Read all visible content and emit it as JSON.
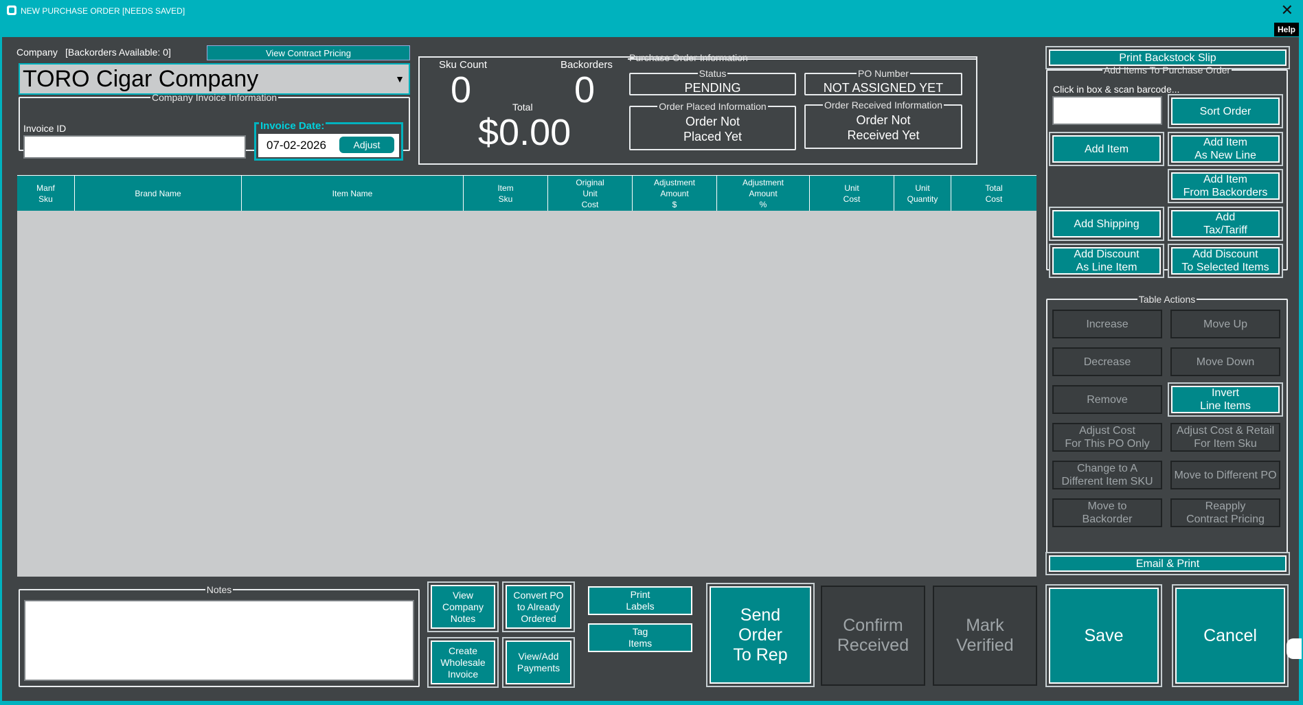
{
  "window": {
    "title": "NEW PURCHASE ORDER [NEEDS SAVED]",
    "help_label": "Help"
  },
  "company": {
    "label": "Company",
    "backorders": "[Backorders Available: 0]",
    "contract_btn": "View Contract Pricing",
    "selected": "TORO Cigar Company"
  },
  "invoice": {
    "group": "Company Invoice Information",
    "id_label": "Invoice ID",
    "id_value": "",
    "date_legend": "Invoice Date:",
    "date_value": "07-02-2026",
    "adjust": "Adjust"
  },
  "summary": {
    "sku_label": "Sku Count",
    "sku_value": "0",
    "back_label": "Backorders",
    "back_value": "0",
    "total_label": "Total",
    "total_value": "$0.00"
  },
  "po": {
    "group": "Purchase Order Information",
    "status_label": "Status",
    "status_value": "PENDING",
    "number_label": "PO Number",
    "number_value": "NOT ASSIGNED YET",
    "placed_label": "Order Placed Information",
    "placed_value": "Order Not\nPlaced Yet",
    "received_label": "Order Received Information",
    "received_value": "Order Not\nReceived Yet"
  },
  "table": {
    "columns": [
      "Manf\nSku",
      "Brand Name",
      "Item Name",
      "Item\nSku",
      "Original\nUnit\nCost",
      "Adjustment\nAmount\n$",
      "Adjustment\nAmount\n%",
      "Unit\nCost",
      "Unit\nQuantity",
      "Total\nCost"
    ],
    "rows": []
  },
  "right": {
    "print_backstock": "Print Backstock Slip",
    "add_group": "Add Items To Purchase Order",
    "scan_label": "Click in box & scan barcode...",
    "scan_value": "",
    "sort_order": "Sort Order",
    "add_item": "Add Item",
    "add_new_line": "Add Item\nAs New Line",
    "add_from_backorders": "Add Item\nFrom Backorders",
    "add_shipping": "Add Shipping",
    "add_tax": "Add\nTax/Tariff",
    "discount_line": "Add Discount\nAs Line Item",
    "discount_selected": "Add Discount\nTo Selected Items",
    "table_actions": "Table Actions",
    "increase": "Increase",
    "move_up": "Move Up",
    "decrease": "Decrease",
    "move_down": "Move Down",
    "remove": "Remove",
    "invert": "Invert\nLine Items",
    "adjust_cost": "Adjust Cost\nFor This PO Only",
    "adjust_retail": "Adjust Cost & Retail\nFor Item Sku",
    "change_sku": "Change to A\nDifferent Item SKU",
    "move_po": "Move to Different PO",
    "move_backorder": "Move to\nBackorder",
    "reapply": "Reapply\nContract Pricing",
    "email_print": "Email & Print"
  },
  "bottom": {
    "notes_label": "Notes",
    "notes_value": "",
    "view_notes": "View\nCompany\nNotes",
    "convert_po": "Convert PO\nto Already\nOrdered",
    "create_invoice": "Create\nWholesale\nInvoice",
    "payments": "View/Add\nPayments",
    "print_labels": "Print\nLabels",
    "tag_items": "Tag\nItems",
    "send_order": "Send\nOrder\nTo Rep",
    "confirm_received": "Confirm\nReceived",
    "mark_verified": "Mark\nVerified",
    "save": "Save",
    "cancel": "Cancel"
  },
  "colors": {
    "accent": "#00b2be",
    "button": "#00888a",
    "panel": "#404446",
    "grid": "#c9cbcc"
  }
}
